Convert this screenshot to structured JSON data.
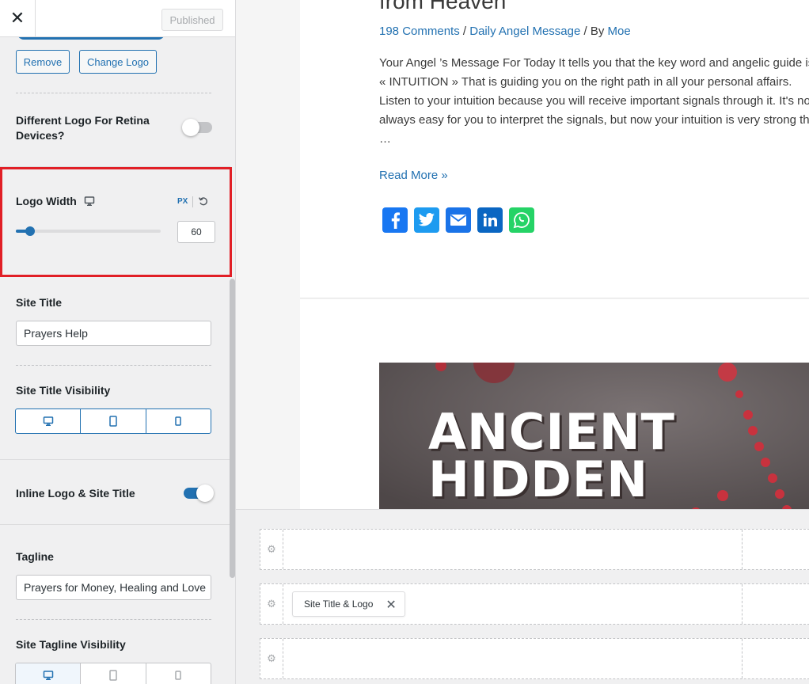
{
  "header": {
    "close_icon": "close-icon",
    "published_label": "Published"
  },
  "logo": {
    "remove_label": "Remove",
    "change_label": "Change Logo"
  },
  "retina": {
    "label_line1": "Different Logo For Retina",
    "label_line2": "Devices?",
    "enabled": false
  },
  "logo_width": {
    "label": "Logo Width",
    "unit": "PX",
    "value": "60",
    "slider_fraction": 0.1
  },
  "site_title": {
    "label": "Site Title",
    "value": "Prayers Help"
  },
  "site_title_visibility": {
    "label": "Site Title Visibility",
    "options": [
      "desktop-icon",
      "tablet-icon",
      "mobile-icon"
    ]
  },
  "inline_logo": {
    "label": "Inline Logo & Site Title",
    "enabled": true
  },
  "tagline": {
    "label": "Tagline",
    "value": "Prayers for Money, Healing and Love"
  },
  "tagline_visibility": {
    "label": "Site Tagline Visibility",
    "options": [
      "desktop-icon",
      "tablet-icon",
      "mobile-icon"
    ],
    "active": "desktop-icon"
  },
  "preview": {
    "post_title": "from Heaven",
    "meta": {
      "comments": "198 Comments",
      "sep1": " / ",
      "category": "Daily Angel Message",
      "sep2": " / By ",
      "author": "Moe"
    },
    "excerpt": "Your Angel ’s Message For Today It tells you that the key word and angelic guide is « INTUITION » That is guiding you on the right path in all your personal affairs. Listen to your intuition because you will receive important signals through it. It's not always easy for you to interpret the signals, but now your intuition is very strong this …",
    "read_more": "Read More »",
    "share": [
      {
        "name": "facebook-icon",
        "color": "#1877f2"
      },
      {
        "name": "twitter-icon",
        "color": "#1d9bf0"
      },
      {
        "name": "email-icon",
        "color": "#1a73e8"
      },
      {
        "name": "linkedin-icon",
        "color": "#0a66c2"
      },
      {
        "name": "whatsapp-icon",
        "color": "#25d366"
      }
    ],
    "featured_text_line1": "ANCIENT",
    "featured_text_line2": "HIDDEN"
  },
  "builder": {
    "chip_label": "Site Title & Logo",
    "gear_icon": "gear-icon"
  },
  "colors": {
    "accent": "#2271b1",
    "highlight": "#e11f26"
  }
}
